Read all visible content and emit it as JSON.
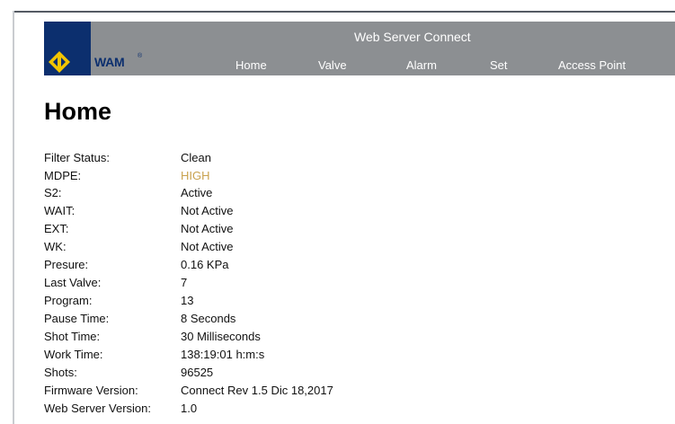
{
  "header": {
    "title": "Web Server Connect",
    "logo_text": "WAM",
    "logo_mark": "®",
    "nav": [
      "Home",
      "Valve",
      "Alarm",
      "Set",
      "Access Point"
    ]
  },
  "page": {
    "title": "Home"
  },
  "status": [
    {
      "label": "Filter Status:",
      "value": "Clean"
    },
    {
      "label": "MDPE:",
      "value": "HIGH",
      "highlight": true
    },
    {
      "label": "S2:",
      "value": "Active"
    },
    {
      "label": "WAIT:",
      "value": "Not Active"
    },
    {
      "label": "EXT:",
      "value": "Not Active"
    },
    {
      "label": "WK:",
      "value": "Not Active"
    },
    {
      "label": "Presure:",
      "value": "0.16 KPa"
    },
    {
      "label": "Last Valve:",
      "value": "7"
    },
    {
      "label": "Program:",
      "value": "13"
    },
    {
      "label": "Pause Time:",
      "value": "8 Seconds"
    },
    {
      "label": "Shot Time:",
      "value": "30 Milliseconds"
    },
    {
      "label": "Work Time:",
      "value": "138:19:01 h:m:s"
    },
    {
      "label": "Shots:",
      "value": "96525"
    },
    {
      "label": "Firmware Version:",
      "value": "Connect Rev 1.5 Dic 18,2017"
    },
    {
      "label": "Web Server Version:",
      "value": "1.0"
    }
  ],
  "colors": {
    "header_bg": "#8c8f92",
    "logo_bg": "#0c2f6e",
    "logo_yellow": "#f2c500",
    "highlight": "#c9a24e"
  }
}
